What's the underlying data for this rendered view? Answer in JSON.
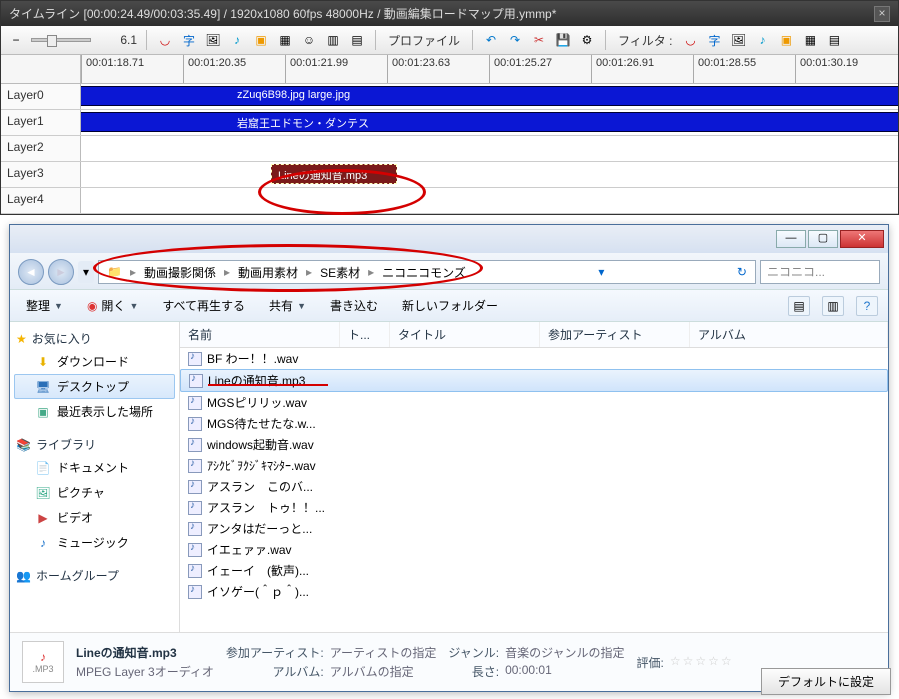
{
  "timeline": {
    "title": "タイムライン [00:00:24.49/00:03:35.49] / 1920x1080 60fps 48000Hz / 動画編集ロードマップ用.ymmp*",
    "zoom": "6.1",
    "toolbar": {
      "profile": "プロファイル",
      "filter": "フィルタ :"
    },
    "ticks": [
      "00:01:18.71",
      "00:01:20.35",
      "00:01:21.99",
      "00:01:23.63",
      "00:01:25.27",
      "00:01:26.91",
      "00:01:28.55",
      "00:01:30.19"
    ],
    "layers": [
      "Layer0",
      "Layer1",
      "Layer2",
      "Layer3",
      "Layer4"
    ],
    "clips": {
      "l0": "zZuq6B98.jpg large.jpg",
      "l1": "岩窟王エドモン・ダンテス",
      "l3": "Lineの通知音.mp3"
    }
  },
  "explorer": {
    "crumbs": [
      "動画撮影関係",
      "動画用素材",
      "SE素材",
      "ニコニコモンズ"
    ],
    "search_placeholder": "ニコニコ...",
    "search_text": "ニコニコ...",
    "toolbar": {
      "organize": "整理",
      "open": "開く",
      "playall": "すべて再生する",
      "share": "共有",
      "burn": "書き込む",
      "newfolder": "新しいフォルダー"
    },
    "sidebar": {
      "fav": "お気に入り",
      "fav_items": [
        "ダウンロード",
        "デスクトップ",
        "最近表示した場所"
      ],
      "lib": "ライブラリ",
      "lib_items": [
        "ドキュメント",
        "ピクチャ",
        "ビデオ",
        "ミュージック"
      ],
      "home": "ホームグループ"
    },
    "columns": {
      "name": "名前",
      "track": "ト...",
      "title": "タイトル",
      "artist": "参加アーティスト",
      "album": "アルバム"
    },
    "files": [
      "BF わー！！.wav",
      "Lineの通知音.mp3",
      "MGSピリリッ.wav",
      "MGS待たせたな.w...",
      "windows起動音.wav",
      "ｱｼｸﾋﾞｦｸｼﾞｷﾏｼﾀｰ.wav",
      "アスラン　このバ...",
      "アスラン　トゥ！！...",
      "アンタはだーっと...",
      "イエェァァ.wav",
      "イェーイ　(歓声)...",
      "イソゲー(＾ｐ＾)..."
    ],
    "selected_index": 1,
    "details": {
      "filename": "Lineの通知音.mp3",
      "type": "MPEG Layer 3オーディオ",
      "icon_text": ".MP3",
      "artist_k": "参加アーティスト:",
      "artist_v": "アーティストの指定",
      "album_k": "アルバム:",
      "album_v": "アルバムの指定",
      "genre_k": "ジャンル:",
      "genre_v": "音楽のジャンルの指定",
      "length_k": "長さ:",
      "length_v": "00:00:01",
      "rating_k": "評価:"
    }
  },
  "footer_button": "デフォルトに設定"
}
